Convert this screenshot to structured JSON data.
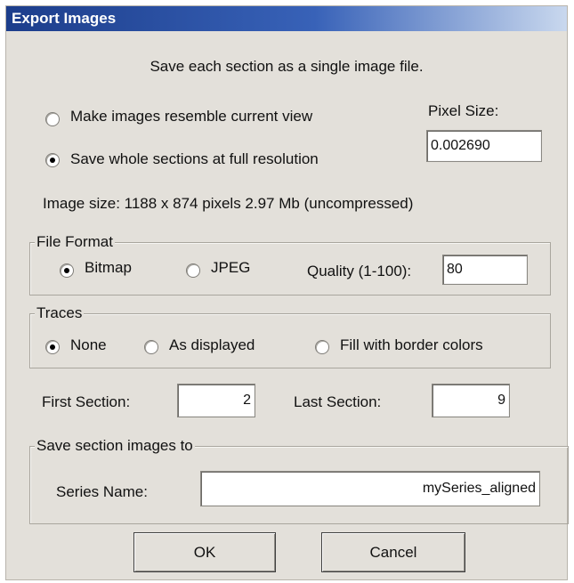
{
  "window": {
    "title": "Export Images"
  },
  "intro_text": "Save each section as a single image file.",
  "view_mode": {
    "options": [
      {
        "label": "Make images resemble current view",
        "selected": false
      },
      {
        "label": "Save whole sections at full resolution",
        "selected": true
      }
    ]
  },
  "pixel_size": {
    "label": "Pixel Size:",
    "value": "0.002690"
  },
  "image_size_text": "Image size: 1188 x 874 pixels  2.97 Mb (uncompressed)",
  "file_format": {
    "group_label": "File Format",
    "options": [
      {
        "label": "Bitmap",
        "selected": true
      },
      {
        "label": "JPEG",
        "selected": false
      }
    ],
    "quality_label": "Quality (1-100):",
    "quality_value": "80"
  },
  "traces": {
    "group_label": "Traces",
    "options": [
      {
        "label": "None",
        "selected": true
      },
      {
        "label": "As displayed",
        "selected": false
      },
      {
        "label": "Fill with border colors",
        "selected": false
      }
    ]
  },
  "sections": {
    "first_label": "First Section:",
    "first_value": "2",
    "last_label": "Last Section:",
    "last_value": "9"
  },
  "save_to": {
    "group_label": "Save section images to",
    "series_label": "Series Name:",
    "series_value": "mySeries_aligned"
  },
  "buttons": {
    "ok": "OK",
    "cancel": "Cancel"
  }
}
